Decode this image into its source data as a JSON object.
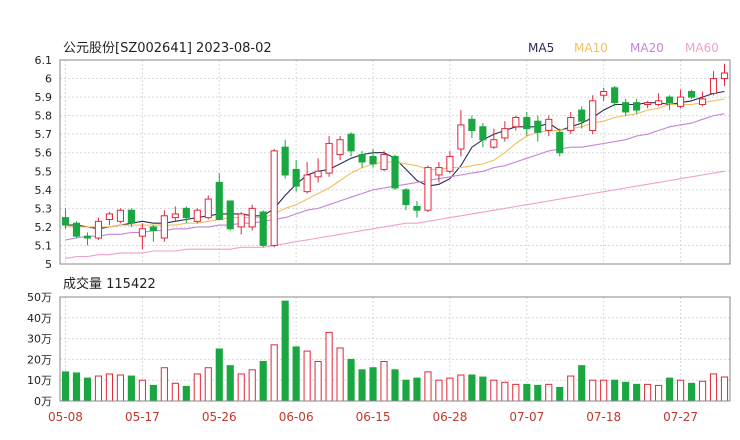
{
  "header": {
    "title": "公元股份[SZ002641] 2023-08-02"
  },
  "legend": [
    {
      "label": "MA5",
      "color": "#2b2b55"
    },
    {
      "label": "MA10",
      "color": "#f0c060"
    },
    {
      "label": "MA20",
      "color": "#c484d8"
    },
    {
      "label": "MA60",
      "color": "#f0a0cc"
    }
  ],
  "colors": {
    "up": "#e0283a",
    "down": "#1aa640",
    "grid": "#d8d8d8",
    "axis": "#888888"
  },
  "chart_data": [
    {
      "type": "candlestick",
      "title": "公元股份[SZ002641] 2023-08-02",
      "ylim": [
        5.0,
        6.1
      ],
      "yticks": [
        "6.1",
        "6",
        "5.9",
        "5.8",
        "5.7",
        "5.6",
        "5.5",
        "5.4",
        "5.3",
        "5.2",
        "5.1",
        "5"
      ],
      "ytick_values": [
        6.1,
        6.0,
        5.9,
        5.8,
        5.7,
        5.6,
        5.5,
        5.4,
        5.3,
        5.2,
        5.1,
        5.0
      ],
      "xtick_labels": [
        "05-08",
        "05-17",
        "05-26",
        "06-06",
        "06-15",
        "06-28",
        "07-07",
        "07-18",
        "07-27"
      ],
      "xtick_index": [
        0,
        7,
        14,
        21,
        28,
        35,
        42,
        49,
        56
      ],
      "ohlc": [
        [
          5.25,
          5.21,
          5.3,
          5.19
        ],
        [
          5.22,
          5.15,
          5.23,
          5.14
        ],
        [
          5.15,
          5.14,
          5.17,
          5.1
        ],
        [
          5.14,
          5.23,
          5.25,
          5.13
        ],
        [
          5.24,
          5.27,
          5.28,
          5.21
        ],
        [
          5.23,
          5.29,
          5.3,
          5.22
        ],
        [
          5.29,
          5.22,
          5.3,
          5.2
        ],
        [
          5.15,
          5.19,
          5.22,
          5.08
        ],
        [
          5.2,
          5.18,
          5.21,
          5.12
        ],
        [
          5.14,
          5.26,
          5.29,
          5.12
        ],
        [
          5.25,
          5.27,
          5.31,
          5.23
        ],
        [
          5.3,
          5.25,
          5.31,
          5.22
        ],
        [
          5.23,
          5.29,
          5.3,
          5.22
        ],
        [
          5.25,
          5.35,
          5.37,
          5.24
        ],
        [
          5.44,
          5.24,
          5.49,
          5.24
        ],
        [
          5.34,
          5.19,
          5.34,
          5.18
        ],
        [
          5.2,
          5.27,
          5.28,
          5.16
        ],
        [
          5.2,
          5.3,
          5.32,
          5.18
        ],
        [
          5.28,
          5.1,
          5.29,
          5.09
        ],
        [
          5.1,
          5.61,
          5.62,
          5.09
        ],
        [
          5.63,
          5.48,
          5.67,
          5.46
        ],
        [
          5.51,
          5.42,
          5.56,
          5.39
        ],
        [
          5.39,
          5.48,
          5.55,
          5.38
        ],
        [
          5.47,
          5.5,
          5.57,
          5.44
        ],
        [
          5.49,
          5.65,
          5.69,
          5.47
        ],
        [
          5.59,
          5.67,
          5.69,
          5.56
        ],
        [
          5.7,
          5.61,
          5.71,
          5.58
        ],
        [
          5.59,
          5.55,
          5.61,
          5.52
        ],
        [
          5.58,
          5.54,
          5.62,
          5.52
        ],
        [
          5.51,
          5.59,
          5.61,
          5.5
        ],
        [
          5.58,
          5.41,
          5.59,
          5.4
        ],
        [
          5.4,
          5.32,
          5.41,
          5.29
        ],
        [
          5.31,
          5.29,
          5.34,
          5.25
        ],
        [
          5.29,
          5.52,
          5.53,
          5.28
        ],
        [
          5.48,
          5.52,
          5.55,
          5.44
        ],
        [
          5.5,
          5.58,
          5.61,
          5.49
        ],
        [
          5.62,
          5.75,
          5.83,
          5.58
        ],
        [
          5.78,
          5.72,
          5.8,
          5.68
        ],
        [
          5.74,
          5.67,
          5.76,
          5.63
        ],
        [
          5.63,
          5.67,
          5.73,
          5.62
        ],
        [
          5.68,
          5.73,
          5.77,
          5.66
        ],
        [
          5.74,
          5.79,
          5.8,
          5.72
        ],
        [
          5.79,
          5.73,
          5.82,
          5.69
        ],
        [
          5.77,
          5.71,
          5.8,
          5.66
        ],
        [
          5.72,
          5.78,
          5.8,
          5.69
        ],
        [
          5.71,
          5.6,
          5.73,
          5.58
        ],
        [
          5.72,
          5.79,
          5.82,
          5.7
        ],
        [
          5.83,
          5.77,
          5.85,
          5.73
        ],
        [
          5.72,
          5.88,
          5.91,
          5.7
        ],
        [
          5.91,
          5.93,
          5.95,
          5.88
        ],
        [
          5.95,
          5.87,
          5.96,
          5.85
        ],
        [
          5.87,
          5.82,
          5.89,
          5.8
        ],
        [
          5.87,
          5.83,
          5.89,
          5.81
        ],
        [
          5.86,
          5.87,
          5.88,
          5.84
        ],
        [
          5.86,
          5.88,
          5.92,
          5.85
        ],
        [
          5.9,
          5.87,
          5.91,
          5.83
        ],
        [
          5.85,
          5.9,
          5.94,
          5.84
        ],
        [
          5.93,
          5.9,
          5.94,
          5.89
        ],
        [
          5.86,
          5.89,
          5.93,
          5.85
        ],
        [
          5.92,
          6.0,
          6.04,
          5.91
        ],
        [
          6.0,
          6.03,
          6.08,
          5.96
        ]
      ],
      "ma": {
        "MA5": [
          5.21,
          5.21,
          5.2,
          5.19,
          5.2,
          5.21,
          5.22,
          5.23,
          5.22,
          5.22,
          5.23,
          5.24,
          5.25,
          5.26,
          5.27,
          5.27,
          5.27,
          5.26,
          5.26,
          5.3,
          5.37,
          5.43,
          5.48,
          5.5,
          5.51,
          5.54,
          5.57,
          5.59,
          5.6,
          5.6,
          5.57,
          5.51,
          5.45,
          5.42,
          5.43,
          5.46,
          5.53,
          5.63,
          5.67,
          5.7,
          5.72,
          5.74,
          5.74,
          5.74,
          5.76,
          5.72,
          5.74,
          5.76,
          5.79,
          5.83,
          5.86,
          5.86,
          5.86,
          5.87,
          5.87,
          5.86,
          5.87,
          5.88,
          5.9,
          5.92,
          5.93
        ],
        "MA10": [
          5.2,
          5.2,
          5.2,
          5.2,
          5.2,
          5.21,
          5.21,
          5.21,
          5.21,
          5.21,
          5.21,
          5.22,
          5.22,
          5.23,
          5.24,
          5.25,
          5.25,
          5.25,
          5.25,
          5.27,
          5.3,
          5.32,
          5.35,
          5.38,
          5.41,
          5.45,
          5.49,
          5.52,
          5.54,
          5.55,
          5.55,
          5.54,
          5.53,
          5.51,
          5.51,
          5.52,
          5.52,
          5.53,
          5.54,
          5.56,
          5.6,
          5.65,
          5.69,
          5.71,
          5.72,
          5.72,
          5.73,
          5.74,
          5.76,
          5.77,
          5.79,
          5.8,
          5.81,
          5.83,
          5.84,
          5.86,
          5.86,
          5.86,
          5.87,
          5.88,
          5.89
        ],
        "MA20": [
          5.13,
          5.14,
          5.15,
          5.15,
          5.16,
          5.16,
          5.17,
          5.17,
          5.18,
          5.18,
          5.19,
          5.19,
          5.2,
          5.2,
          5.21,
          5.21,
          5.22,
          5.22,
          5.23,
          5.24,
          5.25,
          5.27,
          5.29,
          5.3,
          5.32,
          5.34,
          5.36,
          5.38,
          5.4,
          5.41,
          5.42,
          5.43,
          5.44,
          5.45,
          5.46,
          5.47,
          5.48,
          5.49,
          5.5,
          5.52,
          5.53,
          5.55,
          5.57,
          5.59,
          5.61,
          5.62,
          5.63,
          5.63,
          5.64,
          5.65,
          5.66,
          5.67,
          5.69,
          5.7,
          5.72,
          5.74,
          5.75,
          5.76,
          5.78,
          5.8,
          5.81
        ],
        "MA60": [
          5.03,
          5.04,
          5.04,
          5.05,
          5.05,
          5.06,
          5.06,
          5.06,
          5.07,
          5.07,
          5.07,
          5.08,
          5.08,
          5.08,
          5.08,
          5.08,
          5.09,
          5.09,
          5.09,
          5.1,
          5.11,
          5.12,
          5.13,
          5.14,
          5.15,
          5.16,
          5.17,
          5.18,
          5.19,
          5.2,
          5.21,
          5.22,
          5.22,
          5.23,
          5.24,
          5.25,
          5.26,
          5.27,
          5.28,
          5.29,
          5.3,
          5.31,
          5.32,
          5.33,
          5.34,
          5.35,
          5.36,
          5.37,
          5.38,
          5.39,
          5.4,
          5.41,
          5.42,
          5.43,
          5.44,
          5.45,
          5.46,
          5.47,
          5.48,
          5.49,
          5.5
        ]
      }
    },
    {
      "type": "bar",
      "title": "成交量 115422",
      "ylim": [
        0,
        500000
      ],
      "yticks": [
        "50万",
        "40万",
        "30万",
        "20万",
        "10万",
        "0万"
      ],
      "ytick_values": [
        500000,
        400000,
        300000,
        200000,
        100000,
        0
      ],
      "values": [
        140000,
        135000,
        110000,
        120000,
        130000,
        125000,
        120000,
        100000,
        75000,
        160000,
        85000,
        70000,
        130000,
        160000,
        250000,
        170000,
        130000,
        150000,
        190000,
        270000,
        480000,
        260000,
        240000,
        190000,
        330000,
        255000,
        200000,
        150000,
        160000,
        190000,
        150000,
        100000,
        110000,
        140000,
        100000,
        110000,
        125000,
        125000,
        115000,
        100000,
        90000,
        80000,
        80000,
        75000,
        80000,
        65000,
        120000,
        170000,
        100000,
        100000,
        100000,
        90000,
        80000,
        80000,
        75000,
        110000,
        100000,
        85000,
        95000,
        130000,
        115422
      ]
    }
  ]
}
